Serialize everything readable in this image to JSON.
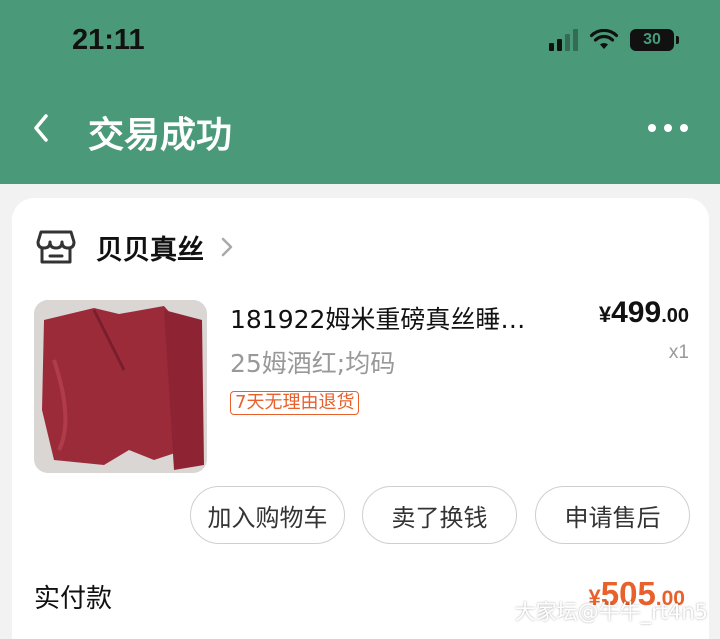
{
  "status_bar": {
    "time": "21:11",
    "battery": "30"
  },
  "header": {
    "title": "交易成功"
  },
  "shop": {
    "name": "贝贝真丝"
  },
  "product": {
    "title": "181922姆米重磅真丝睡…",
    "sku": "25姆酒红;均码",
    "return_badge": "7天无理由退货",
    "price_symbol": "¥",
    "price_int": "499",
    "price_dec": ".00",
    "quantity": "x1",
    "image_color": "#9c2b3a"
  },
  "actions": {
    "add_cart": "加入购物车",
    "sell": "卖了换钱",
    "after_sale": "申请售后"
  },
  "payment": {
    "label": "实付款",
    "symbol": "¥",
    "amount_int": "505",
    "amount_dec": ".00"
  },
  "watermark": "大家坛@牛牛_rt4n5",
  "colors": {
    "header_bg": "#4a9a79",
    "accent": "#e8602c"
  }
}
